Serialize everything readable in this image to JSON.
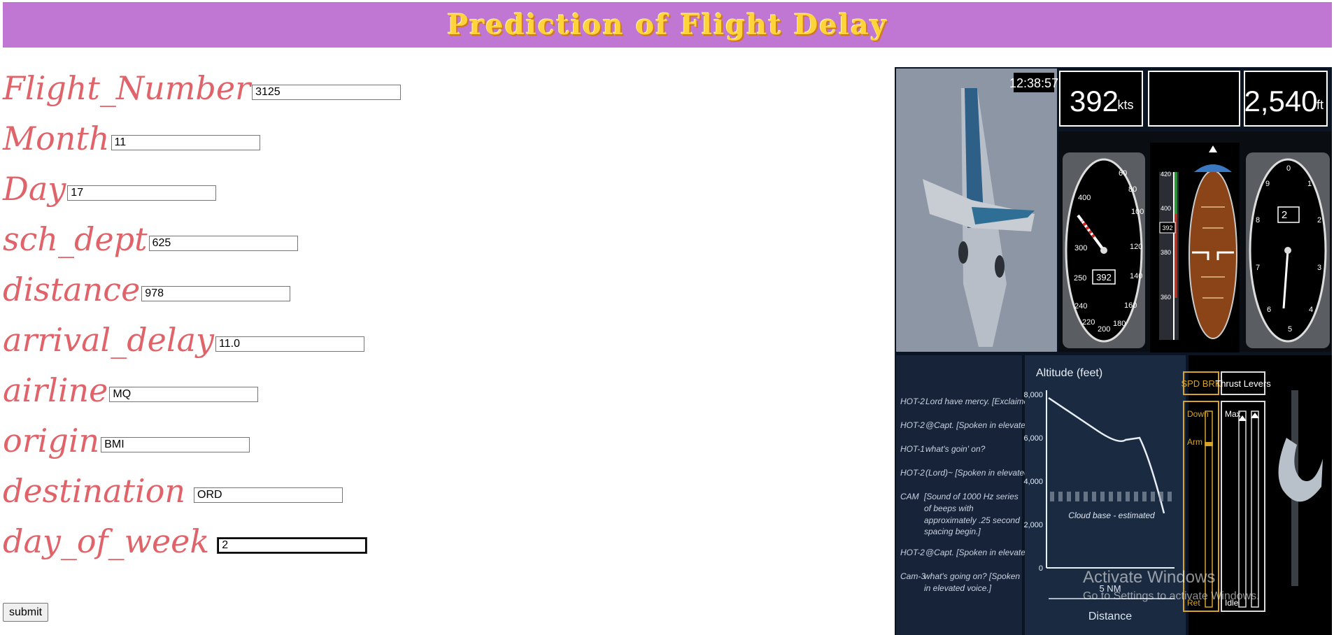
{
  "header": {
    "title": "Prediction of Flight Delay"
  },
  "form": {
    "fields": [
      {
        "label": "Flight_Number",
        "value": "3125"
      },
      {
        "label": "Month",
        "value": "11"
      },
      {
        "label": "Day",
        "value": "17"
      },
      {
        "label": "sch_dept",
        "value": "625"
      },
      {
        "label": "distance",
        "value": "978"
      },
      {
        "label": "arrival_delay",
        "value": "11.0"
      },
      {
        "label": "airline",
        "value": "MQ"
      },
      {
        "label": "origin",
        "value": "BMI"
      },
      {
        "label": "destination",
        "value": "ORD"
      },
      {
        "label": "day_of_week",
        "value": "2"
      }
    ],
    "submit_label": "submit"
  },
  "panel": {
    "clock": "12:38:57",
    "airspeed": "392",
    "airspeed_unit": "kts",
    "altitude": "2,540",
    "altitude_unit": "ft",
    "airspeed_dial_value": "392",
    "asi_ticks": [
      "60",
      "80",
      "100",
      "120",
      "140",
      "160",
      "180",
      "200",
      "220",
      "240",
      "250",
      "300",
      "400"
    ],
    "adi_scale": [
      "420",
      "400",
      "392",
      "380",
      "360"
    ],
    "altimeter_ticks": [
      "0",
      "1",
      "2",
      "3",
      "4",
      "5",
      "6",
      "7",
      "8",
      "9"
    ],
    "altimeter_window": "2",
    "transcript": [
      {
        "speaker": "HOT-2",
        "text": "Lord have mercy. [Exclaimed.]"
      },
      {
        "speaker": "HOT-2",
        "text": "@Capt. [Spoken in elevated voice.]"
      },
      {
        "speaker": "HOT-1",
        "text": "what's goin' on?"
      },
      {
        "speaker": "HOT-2",
        "text": "(Lord)~ [Spoken in elevated voice.]"
      },
      {
        "speaker": "CAM",
        "text": "[Sound of 1000 Hz series of beeps with approximately .25 second spacing begin.]"
      },
      {
        "speaker": "HOT-2",
        "text": "@Capt. [Spoken in elevated voice.]"
      },
      {
        "speaker": "Cam-3",
        "text": "what's going on? [Spoken in elevated voice.]"
      }
    ],
    "alt_chart": {
      "title": "Altitude (feet)",
      "y_ticks": [
        "8,000",
        "6,000",
        "4,000",
        "2,000",
        "0"
      ],
      "cloud_label": "Cloud base - estimated",
      "x_label_top": "5 NM",
      "x_label": "Distance"
    },
    "spd_brk": "SPD BRK",
    "thrust_levers": "Thrust Levers",
    "spd_down": "Down",
    "spd_arm": "Arm",
    "spd_ret": "Ret",
    "thrust_max": "Max",
    "thrust_idle": "Idle"
  },
  "watermark": {
    "title": "Activate Windows",
    "subtitle": "Go to Settings to activate Windows."
  }
}
